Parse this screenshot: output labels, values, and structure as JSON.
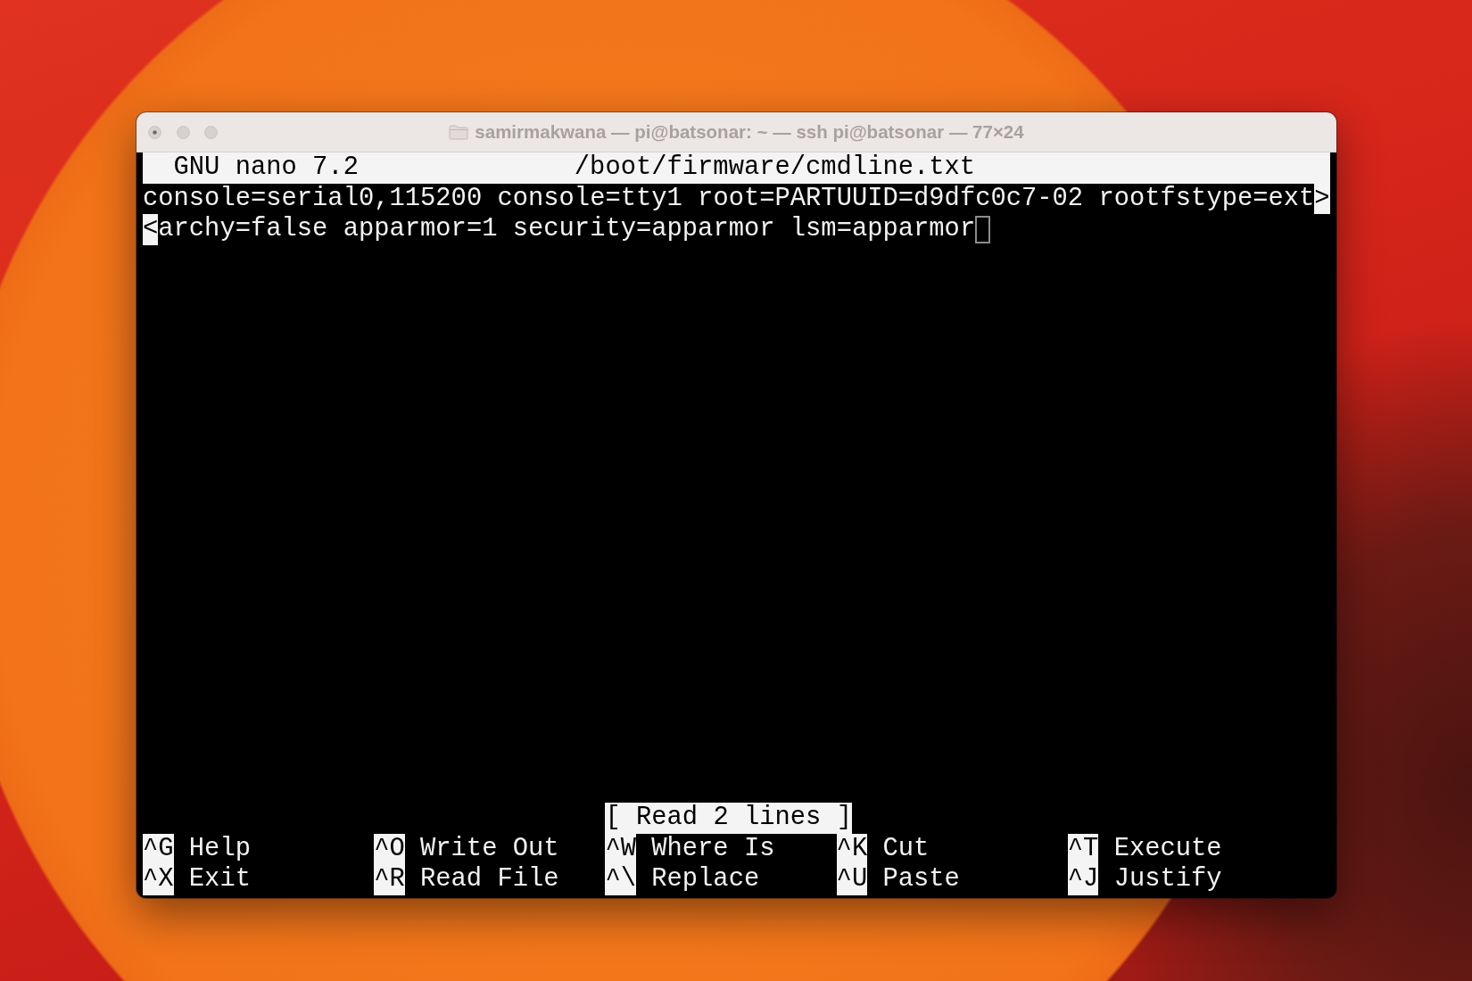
{
  "window": {
    "title": "samirmakwana — pi@batsonar: ~ — ssh pi@batsonar — 77×24",
    "focused": false
  },
  "editor": {
    "app": "GNU nano 7.2",
    "filename": "/boot/firmware/cmdline.txt"
  },
  "lines": [
    {
      "segments": [
        {
          "text": "console=serial0,115200 console=tty1 root=PARTUUID=d9dfc0c7-02 rootfstype=ext",
          "inverse": false
        },
        {
          "text": ">",
          "inverse": true
        }
      ],
      "cursor": false
    },
    {
      "segments": [
        {
          "text": "<",
          "inverse": true
        },
        {
          "text": "archy=false apparmor=1 security=apparmor lsm=apparmor",
          "inverse": false
        }
      ],
      "cursor": true
    }
  ],
  "status": "[ Read 2 lines ]",
  "shortcut_rows": [
    [
      {
        "key": "^G",
        "label": "Help"
      },
      {
        "key": "^O",
        "label": "Write Out"
      },
      {
        "key": "^W",
        "label": "Where Is"
      },
      {
        "key": "^K",
        "label": "Cut"
      },
      {
        "key": "^T",
        "label": "Execute"
      }
    ],
    [
      {
        "key": "^X",
        "label": "Exit"
      },
      {
        "key": "^R",
        "label": "Read File"
      },
      {
        "key": "^\\",
        "label": "Replace"
      },
      {
        "key": "^U",
        "label": "Paste"
      },
      {
        "key": "^J",
        "label": "Justify"
      }
    ]
  ]
}
